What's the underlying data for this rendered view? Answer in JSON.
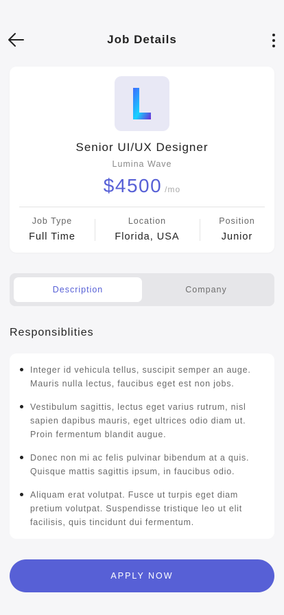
{
  "header": {
    "title": "Job Details",
    "back_icon": "arrow-left-icon",
    "more_icon": "more-vertical-icon"
  },
  "job": {
    "logo_letter": "L",
    "title": "Senior UI/UX Designer",
    "company": "Lumina Wave",
    "salary": "$4500",
    "salary_period": "/mo",
    "stats": [
      {
        "label": "Job Type",
        "value": "Full Time"
      },
      {
        "label": "Location",
        "value": "Florida, USA"
      },
      {
        "label": "Position",
        "value": "Junior"
      }
    ]
  },
  "tabs": [
    {
      "label": "Description",
      "active": true
    },
    {
      "label": "Company",
      "active": false
    }
  ],
  "responsibilities": {
    "heading": "Responsiblities",
    "items": [
      "Integer id vehicula tellus, suscipit semper an auge. Mauris nulla lectus, faucibus eget est non jobs.",
      "Vestibulum sagittis, lectus eget varius rutrum, nisl sapien dapibus mauris, eget ultrices odio diam ut. Proin fermentum blandit augue.",
      "Donec non mi ac felis pulvinar bibendum at a quis. Quisque mattis sagittis ipsum, in faucibus odio.",
      "Aliquam erat volutpat. Fusce ut turpis eget diam pretium volutpat. Suspendisse tristique leo ut elit facilisis, quis tincidunt dui fermentum."
    ]
  },
  "apply": {
    "label": "APPLY NOW"
  },
  "colors": {
    "accent": "#5760d6",
    "background": "#f6f6f8",
    "card": "#ffffff",
    "tab_track": "#e6e6e9",
    "logo_bg": "#e8e8f5",
    "logo_gradient": [
      "#3d6bff",
      "#16d2ff",
      "#6b2bd8"
    ]
  }
}
